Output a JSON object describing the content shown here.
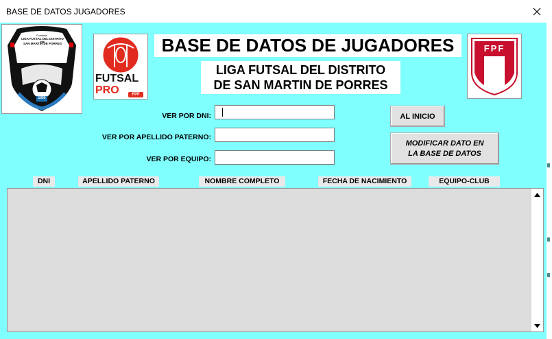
{
  "window": {
    "title": "BASE DE DATOS JUGADORES"
  },
  "header": {
    "main_title": "BASE DE DATOS DE JUGADORES",
    "subtitle_line1": "LIGA FUTSAL DEL DISTRITO",
    "subtitle_line2": "DE SAN MARTIN DE PORRES"
  },
  "logos": {
    "liga": {
      "top_text": "Fundada",
      "line1": "LIGA FUTSAL DEL DISTRITO DE",
      "line2": "SAN MARTIN DE PORRES",
      "year": "1950"
    },
    "futsal": {
      "word1": "FUTSAL",
      "word2": "PRO",
      "badge": "FPF"
    },
    "fpf": {
      "letters": "FPF"
    }
  },
  "search": {
    "dni_label": "VER POR DNI:",
    "dni_value": "",
    "apellido_label": "VER POR APELLIDO PATERNO:",
    "apellido_value": "",
    "equipo_label": "VER POR EQUIPO:",
    "equipo_value": ""
  },
  "buttons": {
    "inicio": "AL INICIO",
    "modificar_line1": "MODIFICAR DATO EN",
    "modificar_line2": "LA BASE DE DATOS"
  },
  "table": {
    "columns": [
      "DNI",
      "APELLIDO PATERNO",
      "NOMBRE COMPLETO",
      "FECHA DE NACIMIENTO",
      "EQUIPO-CLUB"
    ]
  },
  "colors": {
    "background": "#80ffff",
    "list_background": "#dcdcdc"
  }
}
